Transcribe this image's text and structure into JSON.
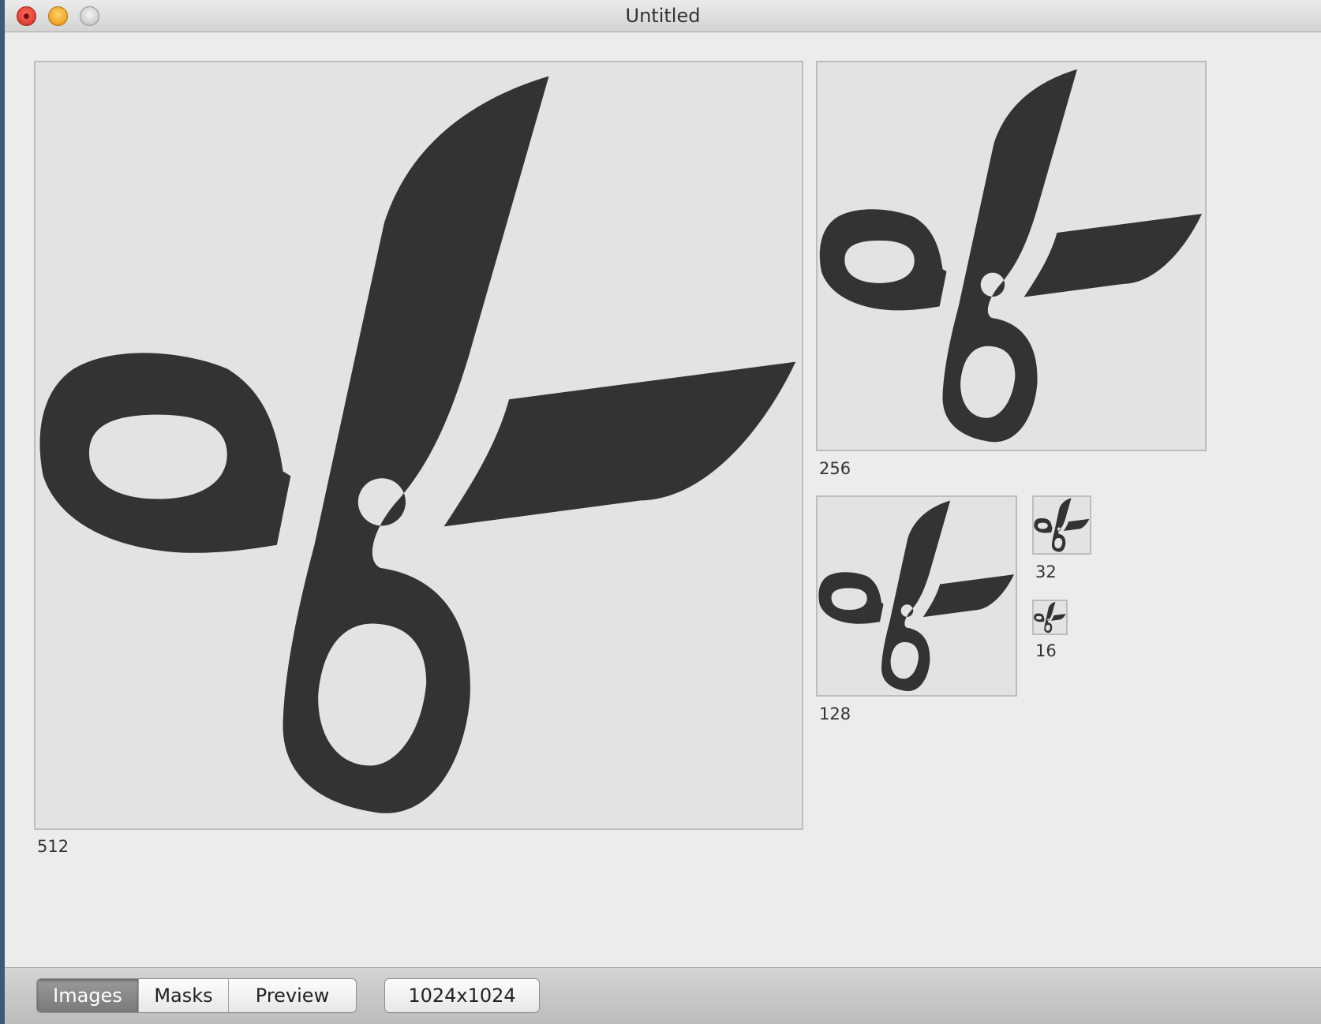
{
  "window": {
    "title": "Untitled"
  },
  "icon_sizes": [
    {
      "label": "512",
      "icon": "scissors-icon"
    },
    {
      "label": "256",
      "icon": "scissors-icon"
    },
    {
      "label": "128",
      "icon": "scissors-icon"
    },
    {
      "label": "32",
      "icon": "scissors-icon"
    },
    {
      "label": "16",
      "icon": "scissors-icon"
    }
  ],
  "toolbar": {
    "tabs": [
      {
        "label": "Images",
        "selected": true
      },
      {
        "label": "Masks",
        "selected": false
      },
      {
        "label": "Preview",
        "selected": false
      }
    ],
    "size_button_label": "1024x1024"
  },
  "colors": {
    "icon_fill": "#333333",
    "well_background": "#e3e3e3",
    "window_background": "#ececec"
  }
}
